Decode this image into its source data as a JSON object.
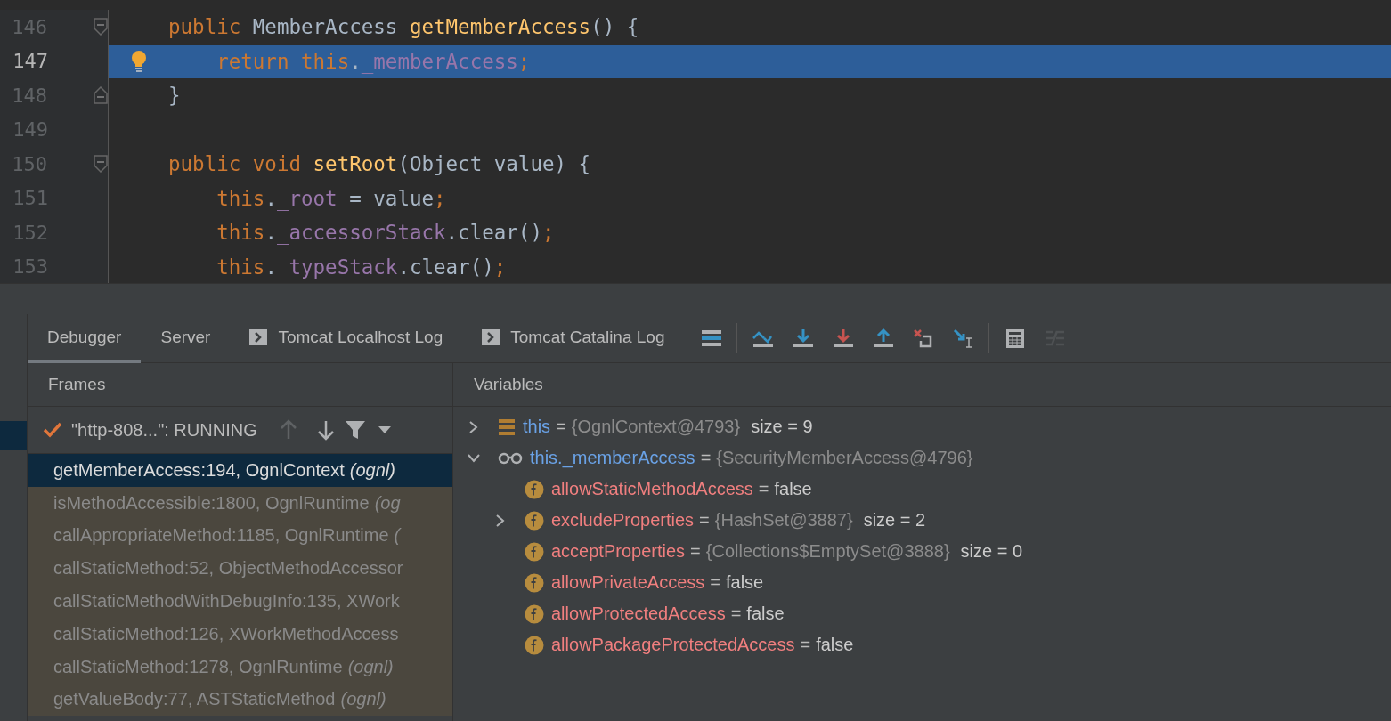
{
  "editor": {
    "lines": [
      {
        "number": "146",
        "current": false,
        "bulb": false,
        "fold_start": true,
        "fold_end": false,
        "tokens": [
          {
            "kind": "keyword",
            "text": "public "
          },
          {
            "kind": "plain",
            "text": "MemberAccess "
          },
          {
            "kind": "method",
            "text": "getMemberAccess"
          },
          {
            "kind": "plain",
            "text": "() {"
          }
        ]
      },
      {
        "number": "147",
        "current": true,
        "bulb": true,
        "fold_start": false,
        "fold_end": false,
        "tokens": [
          {
            "kind": "keyword",
            "text": "    return this"
          },
          {
            "kind": "plain",
            "text": "."
          },
          {
            "kind": "field",
            "text": "_memberAccess"
          },
          {
            "kind": "keyword",
            "text": ";"
          }
        ]
      },
      {
        "number": "148",
        "current": false,
        "bulb": false,
        "fold_start": false,
        "fold_end": true,
        "tokens": [
          {
            "kind": "plain",
            "text": "}"
          }
        ]
      },
      {
        "number": "149",
        "current": false,
        "bulb": false,
        "fold_start": false,
        "fold_end": false
      },
      {
        "number": "150",
        "current": false,
        "bulb": false,
        "fold_start": true,
        "fold_end": false,
        "tokens": [
          {
            "kind": "keyword",
            "text": "public void "
          },
          {
            "kind": "method",
            "text": "setRoot"
          },
          {
            "kind": "plain",
            "text": "(Object value) {"
          }
        ]
      },
      {
        "number": "151",
        "current": false,
        "bulb": false,
        "fold_start": false,
        "fold_end": false,
        "tokens": [
          {
            "kind": "keyword",
            "text": "    this"
          },
          {
            "kind": "plain",
            "text": "."
          },
          {
            "kind": "field",
            "text": "_root"
          },
          {
            "kind": "plain",
            "text": " = value"
          },
          {
            "kind": "keyword",
            "text": ";"
          }
        ]
      },
      {
        "number": "152",
        "current": false,
        "bulb": false,
        "fold_start": false,
        "fold_end": false,
        "tokens": [
          {
            "kind": "keyword",
            "text": "    this"
          },
          {
            "kind": "plain",
            "text": "."
          },
          {
            "kind": "field",
            "text": "_accessorStack"
          },
          {
            "kind": "plain",
            "text": ".clear()"
          },
          {
            "kind": "keyword",
            "text": ";"
          }
        ]
      },
      {
        "number": "153",
        "current": false,
        "bulb": false,
        "fold_start": false,
        "fold_end": false,
        "tokens": [
          {
            "kind": "keyword",
            "text": "    this"
          },
          {
            "kind": "plain",
            "text": "."
          },
          {
            "kind": "field",
            "text": "_typeStack"
          },
          {
            "kind": "plain",
            "text": ".clear()"
          },
          {
            "kind": "keyword",
            "text": ";"
          }
        ]
      }
    ]
  },
  "tool_window": {
    "tabs": [
      {
        "label": "Debugger",
        "selected": true,
        "kind": "plain"
      },
      {
        "label": "Server",
        "selected": false,
        "kind": "plain"
      },
      {
        "label": "Tomcat Localhost Log",
        "selected": false,
        "kind": "console"
      },
      {
        "label": "Tomcat Catalina Log",
        "selected": false,
        "kind": "console"
      }
    ],
    "toolbar": [
      {
        "kind": "frames",
        "disabled": false
      },
      {
        "kind": "sep"
      },
      {
        "kind": "step-over",
        "disabled": false
      },
      {
        "kind": "step-into",
        "disabled": false
      },
      {
        "kind": "force-step-into",
        "disabled": false
      },
      {
        "kind": "step-out",
        "disabled": false
      },
      {
        "kind": "drop-frame",
        "disabled": false
      },
      {
        "kind": "run-to-cursor",
        "disabled": false
      },
      {
        "kind": "sep"
      },
      {
        "kind": "evaluate",
        "disabled": false
      },
      {
        "kind": "trace",
        "disabled": true
      }
    ],
    "frames": {
      "title": "Frames",
      "thread": {
        "label": "\"http-808...\": RUNNING",
        "up_disabled": true
      },
      "rows": [
        {
          "location": "getMemberAccess:194, OgnlContext",
          "package": "(ognl)",
          "selected": true,
          "library": false
        },
        {
          "location": "isMethodAccessible:1800, OgnlRuntime",
          "package": "(og",
          "selected": false,
          "library": true
        },
        {
          "location": "callAppropriateMethod:1185, OgnlRuntime",
          "package": "(",
          "selected": false,
          "library": true
        },
        {
          "location": "callStaticMethod:52, ObjectMethodAccessor",
          "selected": false,
          "library": true
        },
        {
          "location": "callStaticMethodWithDebugInfo:135, XWork",
          "selected": false,
          "library": true
        },
        {
          "location": "callStaticMethod:126, XWorkMethodAccess",
          "selected": false,
          "library": true
        },
        {
          "location": "callStaticMethod:1278, OgnlRuntime",
          "package": "(ognl)",
          "selected": false,
          "library": true
        },
        {
          "location": "getValueBody:77, ASTStaticMethod",
          "package": "(ognl)",
          "selected": false,
          "library": true
        }
      ]
    },
    "variables": {
      "title": "Variables",
      "items": [
        {
          "kind": "local",
          "name": "this",
          "equals": "=",
          "value": "{OgnlContext@4793}",
          "object": true,
          "size": "size = 9",
          "expanded": false
        },
        {
          "kind": "watch",
          "name": "this._memberAccess",
          "equals": "=",
          "value": "{SecurityMemberAccess@4796}",
          "object": true,
          "expanded": true,
          "children": [
            {
              "kind": "field",
              "name": "allowStaticMethodAccess",
              "equals": "=",
              "value": "false",
              "object": false
            },
            {
              "kind": "field",
              "name": "excludeProperties",
              "equals": "=",
              "value": "{HashSet@3887}",
              "object": true,
              "size": "size = 2",
              "expanded": false
            },
            {
              "kind": "field",
              "name": "acceptProperties",
              "equals": "=",
              "value": "{Collections$EmptySet@3888}",
              "object": true,
              "size": "size = 0"
            },
            {
              "kind": "field",
              "name": "allowPrivateAccess",
              "equals": "=",
              "value": "false",
              "object": false
            },
            {
              "kind": "field",
              "name": "allowProtectedAccess",
              "equals": "=",
              "value": "false",
              "object": false
            },
            {
              "kind": "field",
              "name": "allowPackageProtectedAccess",
              "equals": "=",
              "value": "false",
              "object": false
            }
          ]
        }
      ]
    }
  }
}
